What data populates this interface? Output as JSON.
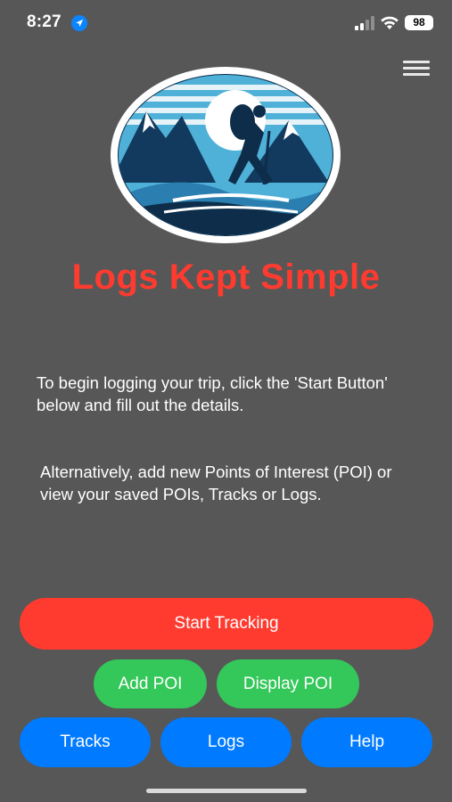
{
  "status_bar": {
    "time": "8:27",
    "battery": "98",
    "icons": [
      "location-arrow-icon",
      "cellular-signal-icon",
      "wifi-icon",
      "battery-icon"
    ]
  },
  "header": {
    "menu_icon": "hamburger-menu-icon"
  },
  "main": {
    "logo": "hiker-mountain-logo",
    "title": "Logs Kept Simple",
    "intro_text": "To begin logging your trip, click the 'Start Button' below and fill out the details.",
    "alt_text": "Alternatively, add new Points of Interest (POI) or view your saved POIs, Tracks or Logs."
  },
  "buttons": {
    "start_tracking": "Start Tracking",
    "add_poi": "Add POI",
    "display_poi": "Display POI",
    "tracks": "Tracks",
    "logs": "Logs",
    "help": "Help"
  },
  "colors": {
    "background": "#575757",
    "title": "#ff3b30",
    "start_button": "#ff3b30",
    "poi_buttons": "#34c759",
    "nav_buttons": "#007aff"
  }
}
